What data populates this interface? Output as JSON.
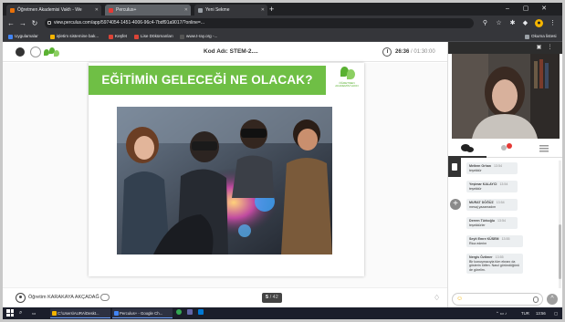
{
  "browser": {
    "tabs": [
      {
        "label": "Öğretmen Akademisi Vakfı - We",
        "color": "#e8710a"
      },
      {
        "label": "Perculus+",
        "color": "#e53935"
      },
      {
        "label": "Yeni Sekme",
        "color": "#9aa0a6"
      }
    ],
    "new_tab": "+",
    "url": "view.perculus.com/app/5974054-1451-4006-96c4-7bdf91a9017/?online=...",
    "bookmarks": [
      {
        "label": "Uygulamalar",
        "color": "#4285f4"
      },
      {
        "label": "işletim sistemine bak...",
        "color": "#f4b400"
      },
      {
        "label": "Keşfet",
        "color": "#db4437"
      },
      {
        "label": "Lise Dökümanları",
        "color": "#db4437"
      },
      {
        "label": "www.t-ray.org -...",
        "color": "#555555"
      }
    ],
    "reading_list": "Okuma listesi"
  },
  "header": {
    "title": "Kod Adı: STEM-2....",
    "timer_elapsed": "26:36",
    "timer_total": "/ 01:30:00"
  },
  "slide": {
    "title": "EĞİTİMİN GELECEĞİ NE OLACAK?",
    "logo_text": "ÖĞRETMEN AKADEMİSİ VAKFI",
    "banner_color": "#6fbf45"
  },
  "footer": {
    "presenter": "Öğretim KARAKAYA AKÇADAĞ",
    "page_current": "5",
    "page_total": "/ 42"
  },
  "chat": {
    "messages": [
      {
        "name": "Meltem Orhan",
        "time": "13:54",
        "text": "teşekkür"
      },
      {
        "name": "Yeşimar KALAYCI",
        "time": "13:54",
        "text": "teşekkür"
      },
      {
        "name": "MURAT DÖĞÜZ",
        "time": "13:54",
        "text": "mesaj yazamadım"
      },
      {
        "name": "Derren Türkoğlu",
        "time": "13:54",
        "text": "teşekkürler"
      },
      {
        "name": "Seyit Emre KÜSEM",
        "time": "13:55",
        "text": "Rica ederim"
      },
      {
        "name": "Nergis Öztimer",
        "time": "13:55",
        "text": "Bir konuşmacıyla tüm ekranı da gösterin lütfen. Nasıl göründüğünü de görelim."
      }
    ],
    "input_placeholder": ""
  },
  "taskbar": {
    "items": [
      {
        "label": "C:\\Users\\AURA\\Deskt...",
        "color": "#f4b400"
      },
      {
        "label": "Perculus+ - Google Ch...",
        "color": "#4285f4"
      }
    ],
    "tray_time": "13:56",
    "tray_lang": "TUR"
  }
}
